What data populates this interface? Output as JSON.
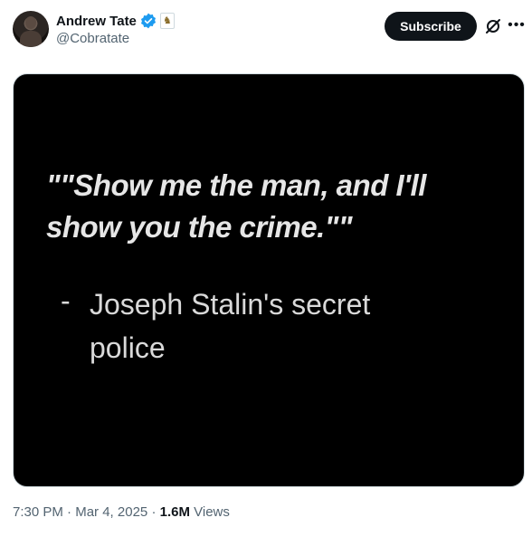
{
  "author": {
    "display_name": "Andrew Tate",
    "handle": "@Cobratate",
    "verified_icon": "verified-badge-icon",
    "affiliate_badge_icon": "knight-chess-icon"
  },
  "actions": {
    "subscribe_label": "Subscribe",
    "grok_icon": "grok-icon",
    "more_icon": "more-icon"
  },
  "media": {
    "quote": "\"\"Show me the man, and I'll show you the crime.\"\"",
    "attribution_dash": "-",
    "attribution": "Joseph Stalin's secret police"
  },
  "meta": {
    "time": "7:30 PM",
    "separator": "·",
    "date": "Mar 4, 2025",
    "views_count": "1.6M",
    "views_label": "Views"
  },
  "colors": {
    "accent": "#1d9bf0",
    "text_primary": "#0f1419",
    "text_secondary": "#536471"
  }
}
